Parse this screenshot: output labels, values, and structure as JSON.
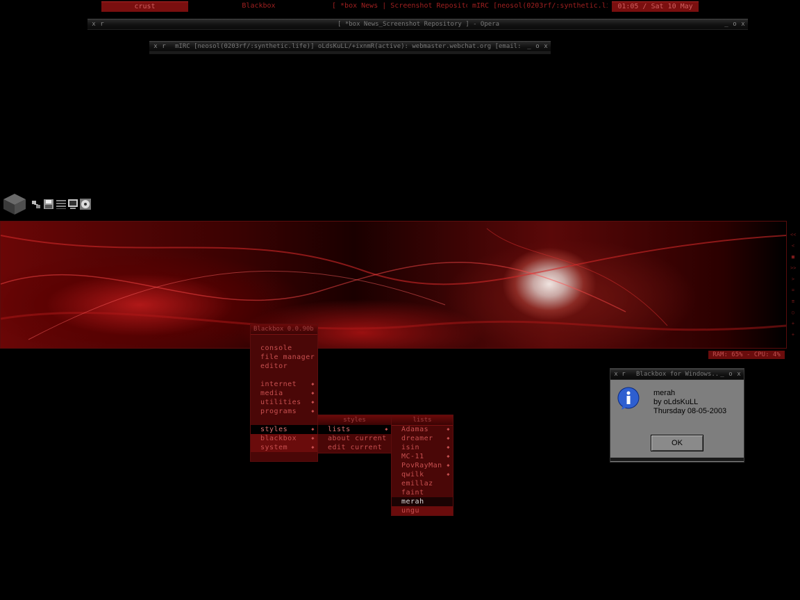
{
  "toolbar": {
    "workspace": "crust",
    "app_name": "Blackbox",
    "task_opera": "[ *box News | Screenshot Repositor...",
    "task_mirc": "mIRC [neosol(0203rf/:synthetic.life]...",
    "clock": "01:05 / Sat 10 May"
  },
  "opera_window": {
    "title": "[ *box News_Screenshot Repository ] - Opera",
    "ctl_left_1": "x",
    "ctl_left_2": "r",
    "ctl_min": "_",
    "ctl_max": "o",
    "ctl_close": "x"
  },
  "mirc_window": {
    "title": "mIRC [neosol(0203rf/:synthetic.life)] oLdsKuLL/+ixnmR(active): webmaster.webchat.org [email: 0] ...",
    "ctl_left_1": "x",
    "ctl_left_2": "r",
    "ctl_min": "_",
    "ctl_max": "o",
    "ctl_close": "x"
  },
  "side_indicators": [
    "<<",
    "<",
    "■",
    ">>",
    ">",
    "=",
    "≡",
    "○",
    "+",
    "+"
  ],
  "ram_label": "RAM: 65% - CPU: 4%",
  "menu_root": {
    "title": "Blackbox 0.0.90b",
    "items": [
      {
        "label": "console",
        "submenu": false
      },
      {
        "label": "file manager",
        "submenu": false
      },
      {
        "label": "editor",
        "submenu": false
      },
      {
        "label": "internet",
        "submenu": true
      },
      {
        "label": "media",
        "submenu": true
      },
      {
        "label": "utilities",
        "submenu": true
      },
      {
        "label": "programs",
        "submenu": true
      },
      {
        "label": "styles",
        "submenu": true
      },
      {
        "label": "blackbox",
        "submenu": true
      },
      {
        "label": "system",
        "submenu": true
      }
    ],
    "arrow": "◆"
  },
  "menu_styles": {
    "title": "styles",
    "items": [
      {
        "label": "lists",
        "submenu": true
      },
      {
        "label": "about current",
        "submenu": false
      },
      {
        "label": "edit current",
        "submenu": false
      }
    ]
  },
  "menu_lists": {
    "title": "lists",
    "items": [
      {
        "label": "Adamas",
        "submenu": true
      },
      {
        "label": "dreamer",
        "submenu": true
      },
      {
        "label": "isin",
        "submenu": true
      },
      {
        "label": "MC-11",
        "submenu": true
      },
      {
        "label": "PovRayMan",
        "submenu": true
      },
      {
        "label": "qwilk",
        "submenu": true
      },
      {
        "label": "emillaz",
        "submenu": false
      },
      {
        "label": "faint",
        "submenu": false
      },
      {
        "label": "merah",
        "submenu": false
      },
      {
        "label": "ungu",
        "submenu": false
      }
    ]
  },
  "dialog": {
    "title": "Blackbox for Windows...",
    "icon": "info-icon",
    "line1": "merah",
    "line2": "by oLdsKuLL",
    "line3": "Thursday 08-05-2003",
    "ok_label": "OK",
    "ctl_left_1": "x",
    "ctl_left_2": "r",
    "ctl_min": "_",
    "ctl_max": "o",
    "ctl_close": "x"
  },
  "dock": {
    "icons": [
      "blackbox-cube-icon",
      "network-icon",
      "save-icon",
      "list-icon",
      "monitor-icon",
      "disc-icon"
    ]
  },
  "colors": {
    "accent": "#7a0f0f",
    "menu_bg": "#4a0707",
    "menu_text": "#c85050",
    "background": "#000000"
  }
}
